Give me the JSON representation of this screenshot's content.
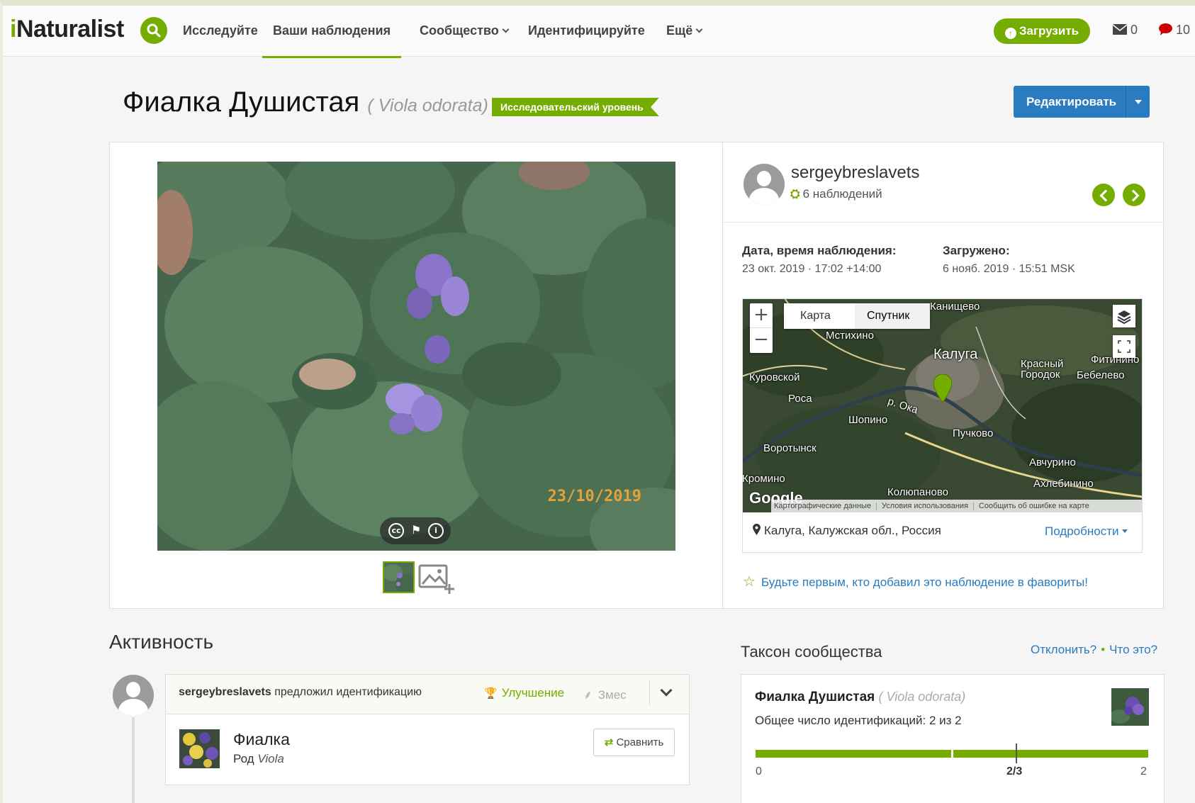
{
  "header": {
    "logo_i": "i",
    "logo_rest": "Naturalist",
    "nav": [
      "Исследуйте",
      "Ваши наблюдения",
      "Сообщество",
      "Идентифицируйте",
      "Ещё"
    ],
    "upload_label": "Загрузить",
    "messages_count": "0",
    "notifications_count": "10"
  },
  "observation": {
    "common_name": "Фиалка Душистая",
    "scientific_name": "( Viola odorata)",
    "quality_badge": "Исследовательский уровень",
    "edit_label": "Редактировать",
    "photo_date_stamp": "23/10/2019"
  },
  "user": {
    "name": "sergeybreslavets",
    "observations": "6 наблюдений"
  },
  "meta": {
    "observed_label": "Дата, время наблюдения:",
    "observed_value": "23 окт. 2019 · 17:02 +14:00",
    "uploaded_label": "Загружено:",
    "uploaded_value": "6 нояб. 2019 · 15:51 MSK"
  },
  "map": {
    "tab_map": "Карта",
    "tab_satellite": "Спутник",
    "labels": [
      "Канищево",
      "Мстихино",
      "Калуга",
      "Куровской",
      "Роса",
      "р. Ока",
      "Шопино",
      "Пучково",
      "Красный Городок",
      "Бебелево",
      "Фитинино",
      "Воротынск",
      "Кромино",
      "Авчурино",
      "Колюпаново",
      "Ахлебинино"
    ],
    "google": "Google",
    "footer": [
      "Картографические данные",
      "Условия использования",
      "Сообщить об ошибке на карте"
    ],
    "place": "Калуга, Калужская обл., Россия",
    "details_link": "Подробности"
  },
  "favorite_text": "Будьте первым, кто добавил это наблюдение в фавориты!",
  "activity": {
    "heading": "Активность",
    "user": "sergeybreslavets",
    "action": " предложил идентификацию",
    "improve_label": "Улучшение",
    "hide_label": "Змес",
    "taxon_name": "Фиалка",
    "rank_prefix": "Род ",
    "rank_name": "Viola",
    "compare_label": "Сравнить"
  },
  "community": {
    "heading": "Таксон сообщества",
    "reject_link": "Отклонить?",
    "what_link": "Что это?",
    "name": "Фиалка Душистая",
    "sci": "( Viola odorata)",
    "total_label": "Общее число идентификаций: 2 из 2",
    "bar_min": "0",
    "bar_mid": "2/3",
    "bar_max": "2",
    "agreement_fraction": 1.0
  },
  "colors": {
    "brand_green": "#74ac00",
    "link_blue": "#2a7bc0",
    "edit_blue": "#2a7bc0"
  }
}
